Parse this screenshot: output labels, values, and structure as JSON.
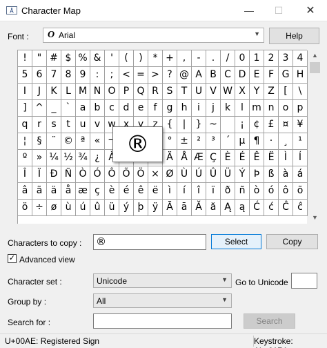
{
  "window": {
    "title": "Character Map",
    "minimize_glyph": "—",
    "maximize_glyph": "☐",
    "close_glyph": "✕"
  },
  "font": {
    "label": "Font :",
    "selected": "Arial",
    "glyph": "O",
    "help_button": "Help"
  },
  "grid": {
    "characters": [
      "!",
      "\"",
      "#",
      "$",
      "%",
      "&",
      "'",
      "(",
      ")",
      "*",
      "+",
      ",",
      "-",
      ".",
      "/",
      "0",
      "1",
      "2",
      "3",
      "4",
      "5",
      "6",
      "7",
      "8",
      "9",
      ":",
      ";",
      "<",
      "=",
      ">",
      "?",
      "@",
      "A",
      "B",
      "C",
      "D",
      "E",
      "F",
      "G",
      "H",
      "I",
      "J",
      "K",
      "L",
      "M",
      "N",
      "O",
      "P",
      "Q",
      "R",
      "S",
      "T",
      "U",
      "V",
      "W",
      "X",
      "Y",
      "Z",
      "[",
      "\\",
      "]",
      "^",
      "_",
      "`",
      "a",
      "b",
      "c",
      "d",
      "e",
      "f",
      "g",
      "h",
      "i",
      "j",
      "k",
      "l",
      "m",
      "n",
      "o",
      "p",
      "q",
      "r",
      "s",
      "t",
      "u",
      "v",
      "w",
      "x",
      "y",
      "z",
      "{",
      "|",
      "}",
      "~",
      " ",
      "¡",
      "¢",
      "£",
      "¤",
      "¥",
      "¦",
      "§",
      "¨",
      "©",
      "ª",
      "«",
      "¬",
      "­",
      "®",
      "¯",
      "°",
      "±",
      "²",
      "³",
      "´",
      "µ",
      "¶",
      "·",
      "¸",
      "¹",
      "º",
      "»",
      "¼",
      "½",
      "¾",
      "¿",
      "À",
      "Á",
      "Â",
      "Ã",
      "Ä",
      "Å",
      "Æ",
      "Ç",
      "È",
      "É",
      "Ê",
      "Ë",
      "Ì",
      "Í",
      "Î",
      "Ï",
      "Ð",
      "Ñ",
      "Ò",
      "Ó",
      "Ô",
      "Õ",
      "Ö",
      "×",
      "Ø",
      "Ù",
      "Ú",
      "Û",
      "Ü",
      "Ý",
      "Þ",
      "ß",
      "à",
      "á",
      "â",
      "ã",
      "ä",
      "å",
      "æ",
      "ç",
      "è",
      "é",
      "ê",
      "ë",
      "ì",
      "í",
      "î",
      "ï",
      "ð",
      "ñ",
      "ò",
      "ó",
      "ô",
      "õ",
      "ö",
      "÷",
      "ø",
      "ù",
      "ú",
      "û",
      "ü",
      "ý",
      "þ",
      "ÿ",
      "Ā",
      "ā",
      "Ă",
      "ă",
      "Ą",
      "ą",
      "Ć",
      "ć",
      "Ĉ",
      "ĉ"
    ],
    "selected_char": "®"
  },
  "copy": {
    "label": "Characters to copy :",
    "value": "®",
    "select_button": "Select",
    "copy_button": "Copy"
  },
  "advanced": {
    "label": "Advanced view",
    "checked": true
  },
  "charset": {
    "label": "Character set :",
    "value": "Unicode",
    "goto_label": "Go to Unicode :",
    "goto_value": ""
  },
  "groupby": {
    "label": "Group by :",
    "value": "All"
  },
  "search": {
    "label": "Search for :",
    "value": "",
    "button": "Search"
  },
  "status": {
    "char_info": "U+00AE: Registered Sign",
    "keystroke": "Keystroke: Alt+0174"
  }
}
